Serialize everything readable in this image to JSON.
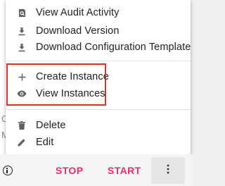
{
  "menu": {
    "items": [
      {
        "label": "View Audit Activity",
        "icon": "audit-search-icon"
      },
      {
        "label": "Download Version",
        "icon": "download-icon"
      },
      {
        "label": "Download Configuration Template",
        "icon": "download-icon"
      },
      {
        "label": "Create Instance",
        "icon": "plus-icon"
      },
      {
        "label": "View Instances",
        "icon": "eye-icon"
      },
      {
        "label": "Delete",
        "icon": "trash-icon"
      },
      {
        "label": "Edit",
        "icon": "pencil-icon"
      }
    ]
  },
  "background": {
    "partial_text_1": "C",
    "partial_text_2": "M"
  },
  "actions": {
    "stop_label": "STOP",
    "start_label": "START",
    "more_icon": "more-vertical-icon"
  },
  "colors": {
    "accent": "#e0306a",
    "highlight_border": "#d32f2f",
    "text": "#212121",
    "icon": "#5f5f5f"
  }
}
